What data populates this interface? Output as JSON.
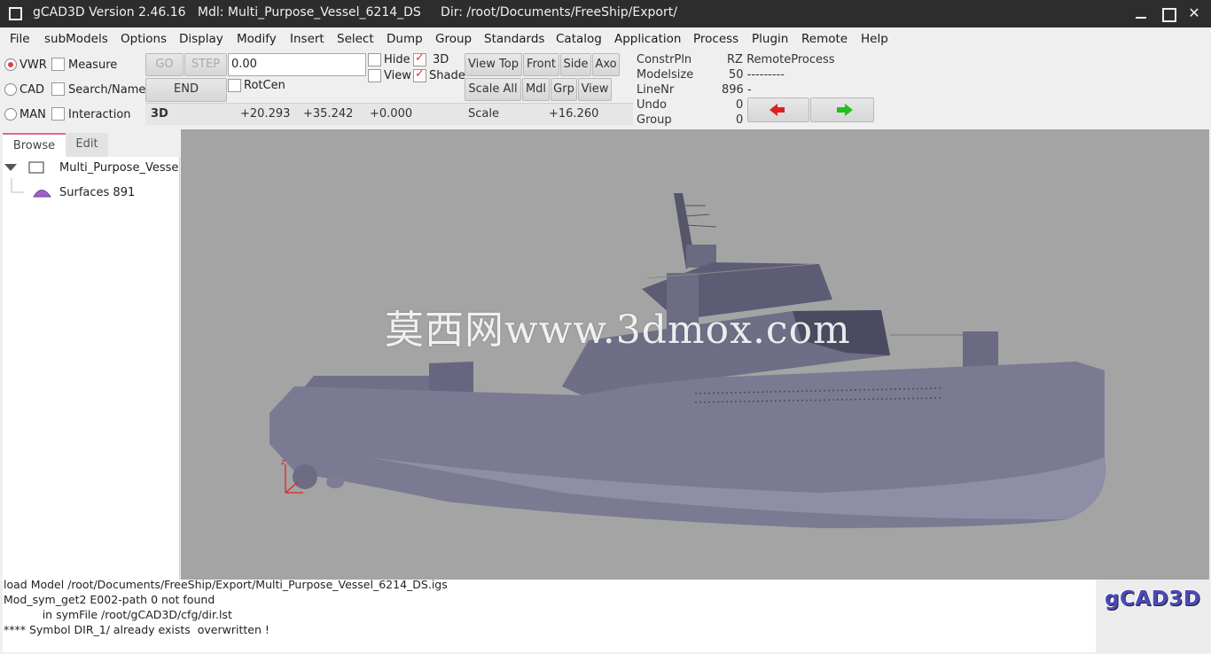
{
  "window": {
    "title": "gCAD3D Version 2.46.16   Mdl: Multi_Purpose_Vessel_6214_DS     Dir: /root/Documents/FreeShip/Export/"
  },
  "menu": [
    "File",
    "subModels",
    "Options",
    "Display",
    "Modify",
    "Insert",
    "Select",
    "Dump",
    "Group",
    "Standards",
    "Catalog",
    "Application",
    "Process",
    "Plugin",
    "Remote",
    "Help"
  ],
  "toolbar": {
    "modes": {
      "vwr": "VWR",
      "cad": "CAD",
      "man": "MAN",
      "selected": "VWR"
    },
    "options": {
      "measure": "Measure",
      "search": "Search/Name",
      "interaction": "Interaction"
    },
    "go": "GO",
    "step": "STEP",
    "end": "END",
    "input_value": "0.00",
    "hide": "Hide",
    "view": "View",
    "rotcen": "RotCen",
    "d3": "3D",
    "shade": "Shade",
    "view_buttons": {
      "top": "View Top",
      "front": "Front",
      "side": "Side",
      "axo": "Axo",
      "scale_all": "Scale All",
      "mdl": "Mdl",
      "grp": "Grp",
      "view": "View"
    },
    "coords": {
      "label": "3D",
      "x": "+20.293",
      "y": "+35.242",
      "z": "+0.000"
    },
    "scale": {
      "label": "Scale",
      "value": "+16.260"
    }
  },
  "info": {
    "constrpln_label": "ConstrPln",
    "constrpln_value": "RZ RemoteProcess",
    "modelsize_label": "Modelsize",
    "modelsize_value": "50 ---------",
    "linenr_label": "LineNr",
    "linenr_value": "896 -",
    "undo_label": "Undo",
    "undo_value": "0",
    "group_label": "Group",
    "group_value": "0"
  },
  "panel": {
    "tabs": [
      "Browse",
      "Edit"
    ],
    "tree": {
      "root": "Multi_Purpose_Vesse",
      "child": "Surfaces 891"
    }
  },
  "viewport": {
    "watermark": "莫西网www.3dmox.com"
  },
  "messages": [
    "load Model /root/Documents/FreeShip/Export/Multi_Purpose_Vessel_6214_DS.igs",
    "Mod_sym_get2 E002-path 0 not found",
    "           in symFile /root/gCAD3D/cfg/dir.lst",
    "**** Symbol DIR_1/ already exists  overwritten !"
  ],
  "logo": "gCAD3D",
  "colors": {
    "titlebar": "#2d2d2d",
    "viewport_bg": "#a4a4a4",
    "hull": "#7a7a92",
    "logo": "#4a4ab8",
    "axis": "#e02020"
  }
}
